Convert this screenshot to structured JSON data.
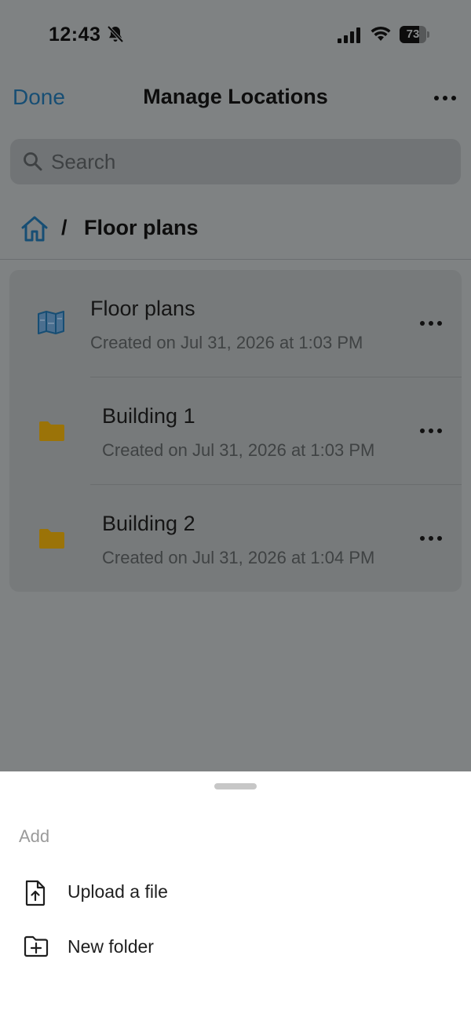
{
  "status_bar": {
    "time": "12:43",
    "battery_level": "73",
    "battery_fraction": 0.73
  },
  "nav": {
    "done_label": "Done",
    "title": "Manage Locations"
  },
  "search": {
    "placeholder": "Search"
  },
  "breadcrumb": {
    "separator": "/",
    "current": "Floor plans"
  },
  "items": [
    {
      "title": "Floor plans",
      "subtitle": "Created on Jul 31, 2026 at 1:03 PM",
      "icon": "map-icon"
    },
    {
      "title": "Building 1",
      "subtitle": "Created on Jul 31, 2026 at 1:03 PM",
      "icon": "folder-icon"
    },
    {
      "title": "Building 2",
      "subtitle": "Created on Jul 31, 2026 at 1:04 PM",
      "icon": "folder-icon"
    }
  ],
  "sheet": {
    "header": "Add",
    "actions": [
      {
        "label": "Upload a file",
        "icon": "upload-file-icon"
      },
      {
        "label": "New folder",
        "icon": "new-folder-icon"
      }
    ]
  },
  "colors": {
    "accent": "#174e74",
    "folder": "#9b7308",
    "overlay": "#7f8283",
    "sheet": "#ffffff"
  }
}
